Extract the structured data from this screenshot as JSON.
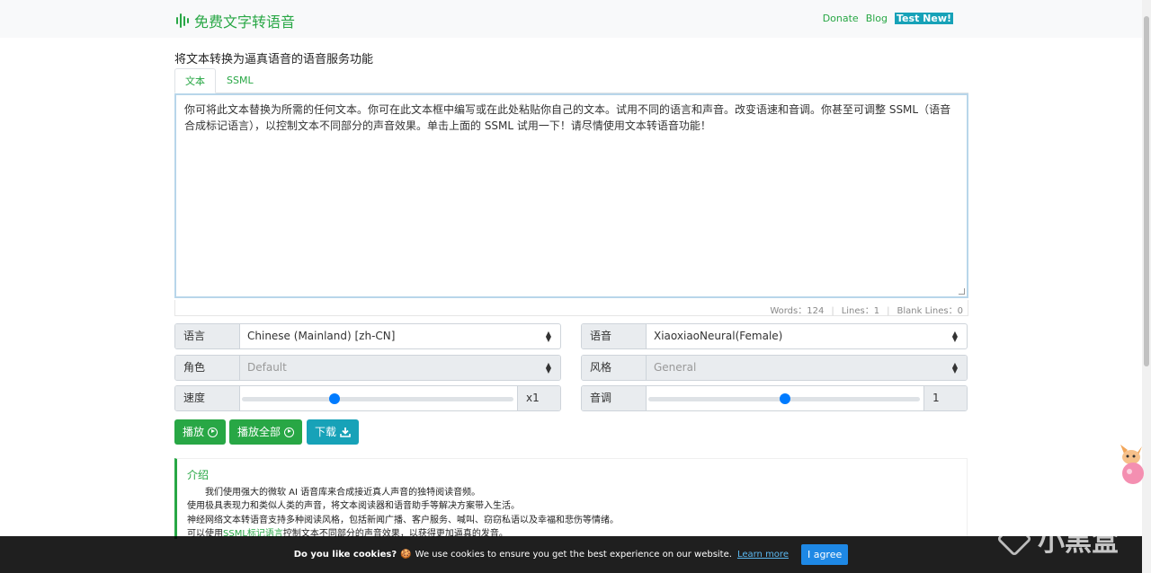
{
  "nav": {
    "brand": "免费文字转语音",
    "donate": "Donate",
    "blog": "Blog",
    "test_new": "Test New!"
  },
  "page_title": "将文本转换为逼真语音的语音服务功能",
  "tabs": [
    {
      "label": "文本",
      "active": true
    },
    {
      "label": "SSML",
      "active": false
    }
  ],
  "editor": {
    "text": "你可将此文本替换为所需的任何文本。你可在此文本框中编写或在此处粘贴你自己的文本。试用不同的语言和声音。改变语速和音调。你甚至可调整 SSML（语音合成标记语言），以控制文本不同部分的声音效果。单击上面的 SSML 试用一下！请尽情使用文本转语音功能！"
  },
  "stats": {
    "words": "Words：124",
    "lines": "Lines：1",
    "blank_lines": "Blank Lines：0"
  },
  "controls": {
    "language": {
      "label": "语言",
      "value": "Chinese (Mainland) [zh-CN]"
    },
    "voice": {
      "label": "语音",
      "value": "XiaoxiaoNeural(Female)"
    },
    "role": {
      "label": "角色",
      "value": "Default"
    },
    "style": {
      "label": "风格",
      "value": "General"
    },
    "speed": {
      "label": "速度",
      "value": "x1",
      "position": 0.34
    },
    "pitch": {
      "label": "音调",
      "value": "1",
      "position": 0.5
    }
  },
  "buttons": {
    "play": "播放",
    "play_all": "播放全部",
    "download": "下载"
  },
  "intro": {
    "title": "介绍",
    "line1": "我们使用强大的微软 AI 语音库来合成接近真人声音的独特阅读音频。",
    "line2": "使用极具表现力和类似人类的声音，将文本阅读器和语音助手等解决方案带入生活。",
    "line3": "神经网络文本转语音支持多种阅读风格，包括新闻广播、客户服务、喊叫、窃窃私语以及幸福和悲伤等情绪。",
    "line4_prefix": "可以使用",
    "line4_link": "SSML标记语言",
    "line4_suffix": "控制文本不同部分的声音效果，以获得更加逼真的发音。"
  },
  "cookie": {
    "question": "Do you like cookies?",
    "emoji": "🍪",
    "message": "We use cookies to ensure you get the best experience on our website.",
    "learn_more": "Learn more",
    "agree": "I agree"
  },
  "watermark": "小黑盒",
  "colors": {
    "brand_green": "#28a745",
    "accent_teal": "#17a2b8",
    "slider_blue": "#007bff",
    "agree_blue": "#1e88e5"
  }
}
